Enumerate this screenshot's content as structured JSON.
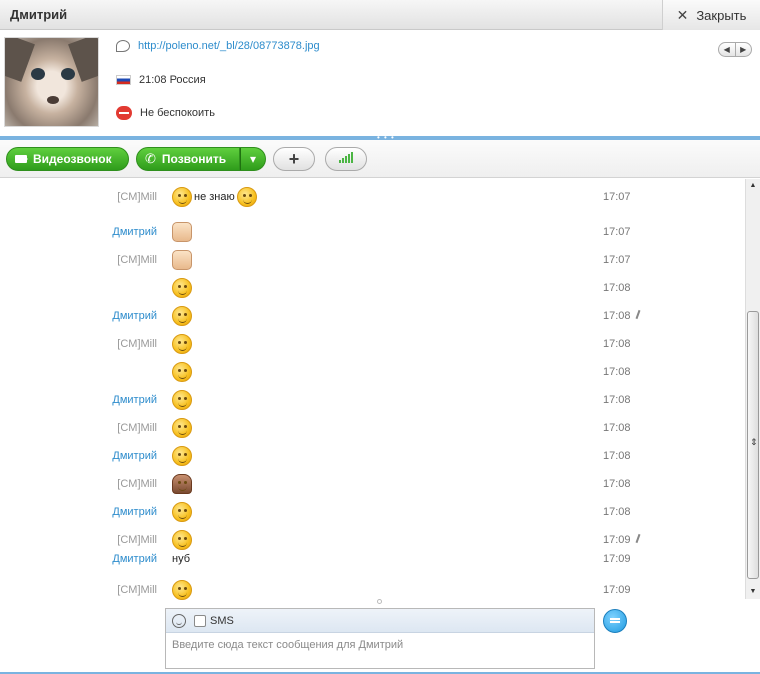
{
  "window": {
    "contact_name": "Дмитрий",
    "close_label": "Закрыть"
  },
  "profile": {
    "mood_link": "http://poleno.net/_bl/28/08773878.jpg",
    "local_time": "21:08 Россия",
    "status": "Не беспокоить"
  },
  "toolbar": {
    "video_call": "Видеозвонок",
    "call": "Позвонить"
  },
  "messages": [
    {
      "sender": "[CM]Mill",
      "text": "не знаю",
      "time": "17:07"
    },
    {
      "sender": "Дмитрий",
      "text": "",
      "time": "17:07"
    },
    {
      "sender": "[CM]Mill",
      "text": "",
      "time": "17:07"
    },
    {
      "sender": "",
      "text": "",
      "time": "17:08"
    },
    {
      "sender": "Дмитрий",
      "text": "",
      "time": "17:08"
    },
    {
      "sender": "[CM]Mill",
      "text": "",
      "time": "17:08"
    },
    {
      "sender": "",
      "text": "",
      "time": "17:08"
    },
    {
      "sender": "Дмитрий",
      "text": "",
      "time": "17:08"
    },
    {
      "sender": "[CM]Mill",
      "text": "",
      "time": "17:08"
    },
    {
      "sender": "Дмитрий",
      "text": "",
      "time": "17:08"
    },
    {
      "sender": "[CM]Mill",
      "text": "",
      "time": "17:08"
    },
    {
      "sender": "Дмитрий",
      "text": "",
      "time": "17:08"
    },
    {
      "sender": "[CM]Mill",
      "text": "",
      "time": "17:09"
    },
    {
      "sender": "Дмитрий",
      "text": "нуб",
      "time": "17:09"
    },
    {
      "sender": "[CM]Mill",
      "text": "",
      "time": "17:09"
    }
  ],
  "compose": {
    "sms_label": "SMS",
    "placeholder": "Введите сюда текст сообщения для Дмитрий"
  }
}
